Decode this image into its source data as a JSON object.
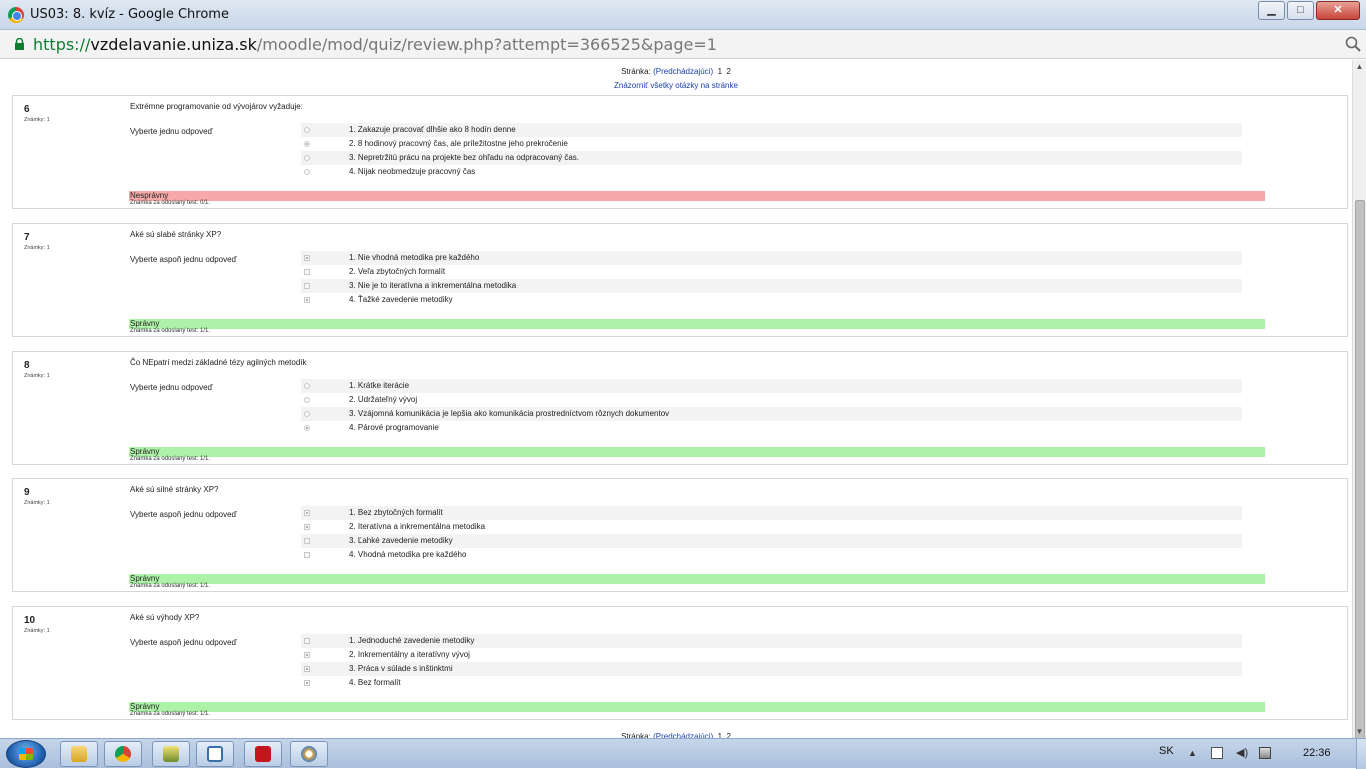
{
  "window": {
    "title": "US03: 8. kvíz - Google Chrome"
  },
  "address": {
    "scheme": "https://",
    "host": "vzdelavanie.uniza.sk",
    "path": "/moodle/mod/quiz/review.php?attempt=366525&page=1"
  },
  "pager": {
    "label": "Stránka:",
    "prev": "(Predchádzajúci)",
    "page1": "1",
    "page2": "2"
  },
  "show_all": "Znázorniť všetky otázky na stránke",
  "questions": [
    {
      "num": "6",
      "grade": "Známky: 1",
      "text": "Extrémne programovanie od vývojárov vyžaduje:",
      "prompt": "Vyberte jednu odpoveď",
      "type": "radio",
      "answers": [
        {
          "label": "1. Zakazuje pracovať dlhšie ako 8 hodín denne",
          "selected": false
        },
        {
          "label": "2. 8 hodinový pracovný čas, ale príležitostne jeho prekročenie",
          "selected": true
        },
        {
          "label": "3. Nepretržitú prácu na projekte bez ohľadu na odpracovaný čas.",
          "selected": false
        },
        {
          "label": "4. Nijak neobmedzuje pracovný čas",
          "selected": false
        }
      ],
      "result": "Nesprávny",
      "result_status": "incorrect",
      "points": "Známka za odoslaný test: 0/1."
    },
    {
      "num": "7",
      "grade": "Známky: 1",
      "text": "Aké sú slabé stránky XP?",
      "prompt": "Vyberte aspoň jednu odpoveď",
      "type": "checkbox",
      "answers": [
        {
          "label": "1. Nie vhodná metodika pre každého",
          "selected": true
        },
        {
          "label": "2. Veľa zbytočných formalít",
          "selected": false
        },
        {
          "label": "3. Nie je to iteratívna a inkrementálna metodika",
          "selected": false
        },
        {
          "label": "4. Ťažké zavedenie metodiky",
          "selected": true
        }
      ],
      "result": "Správny",
      "result_status": "correct",
      "points": "Známka za odoslaný test: 1/1."
    },
    {
      "num": "8",
      "grade": "Známky: 1",
      "text": "Čo NEpatrí medzi základné tézy agilných metodík",
      "prompt": "Vyberte jednu odpoveď",
      "type": "radio",
      "answers": [
        {
          "label": "1. Krátke iterácie",
          "selected": false
        },
        {
          "label": "2. Udržateľný vývoj",
          "selected": false
        },
        {
          "label": "3. Vzájomná komunikácia je lepšia ako komunikácia prostredníctvom rôznych dokumentov",
          "selected": false
        },
        {
          "label": "4. Párové programovanie",
          "selected": true
        }
      ],
      "result": "Správny",
      "result_status": "correct",
      "points": "Známka za odoslaný test: 1/1."
    },
    {
      "num": "9",
      "grade": "Známky: 1",
      "text": "Aké sú silné stránky XP?",
      "prompt": "Vyberte aspoň jednu odpoveď",
      "type": "checkbox",
      "answers": [
        {
          "label": "1. Bez zbytočných formalít",
          "selected": true
        },
        {
          "label": "2. Iteratívna a inkrementálna metodika",
          "selected": true
        },
        {
          "label": "3. Ľahké zavedenie metodiky",
          "selected": false
        },
        {
          "label": "4. Vhodná metodika pre každého",
          "selected": false
        }
      ],
      "result": "Správny",
      "result_status": "correct",
      "points": "Známka za odoslaný test: 1/1."
    },
    {
      "num": "10",
      "grade": "Známky: 1",
      "text": "Aké sú výhody XP?",
      "prompt": "Vyberte aspoň jednu odpoveď",
      "type": "checkbox",
      "answers": [
        {
          "label": "1. Jednoduché zavedenie metodiky",
          "selected": false
        },
        {
          "label": "2. Inkrementálny a iteratívny vývoj",
          "selected": true
        },
        {
          "label": "3. Práca v súlade s inštinktmi",
          "selected": true
        },
        {
          "label": "4. Bez formalít",
          "selected": true
        }
      ],
      "result": "Správny",
      "result_status": "correct",
      "points": "Známka za odoslaný test: 1/1."
    }
  ],
  "taskbar": {
    "apps": [
      "file-explorer-icon",
      "chrome-icon",
      "tool-icon",
      "window-icon",
      "pdf-icon",
      "paint-icon"
    ],
    "lang": "SK",
    "clock": "22:36"
  },
  "colors": {
    "incorrect": "#f7a9a9",
    "correct": "#aef2aa",
    "link": "#1a3fa8"
  }
}
